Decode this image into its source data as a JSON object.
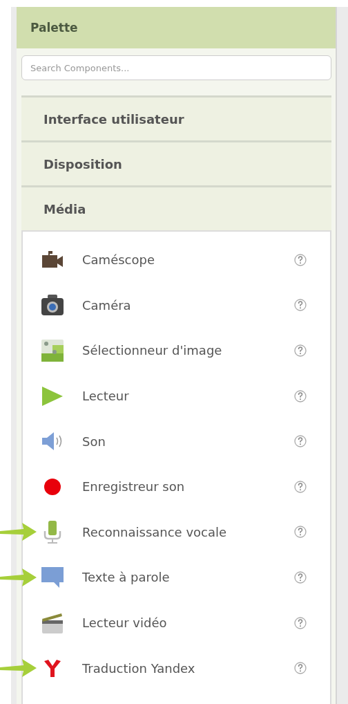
{
  "palette": {
    "title": "Palette",
    "search": {
      "placeholder": "Search Components..."
    },
    "categories": [
      {
        "label": "Interface utilisateur"
      },
      {
        "label": "Disposition"
      },
      {
        "label": "Média",
        "items": [
          {
            "kind": "camcorder",
            "label": "Caméscope",
            "marked": false
          },
          {
            "kind": "camera",
            "label": "Caméra",
            "marked": false
          },
          {
            "kind": "image-picker",
            "label": "Sélectionneur d'image",
            "marked": false
          },
          {
            "kind": "player",
            "label": "Lecteur",
            "marked": false
          },
          {
            "kind": "sound",
            "label": "Son",
            "marked": false
          },
          {
            "kind": "recorder",
            "label": "Enregistreur son",
            "marked": false
          },
          {
            "kind": "speech-recognizer",
            "label": "Reconnaissance vocale",
            "marked": true
          },
          {
            "kind": "text-to-speech",
            "label": "Texte à parole",
            "marked": true
          },
          {
            "kind": "video-player",
            "label": "Lecteur vidéo",
            "marked": false
          },
          {
            "kind": "yandex",
            "label": "Traduction Yandex",
            "marked": true
          }
        ]
      }
    ]
  }
}
